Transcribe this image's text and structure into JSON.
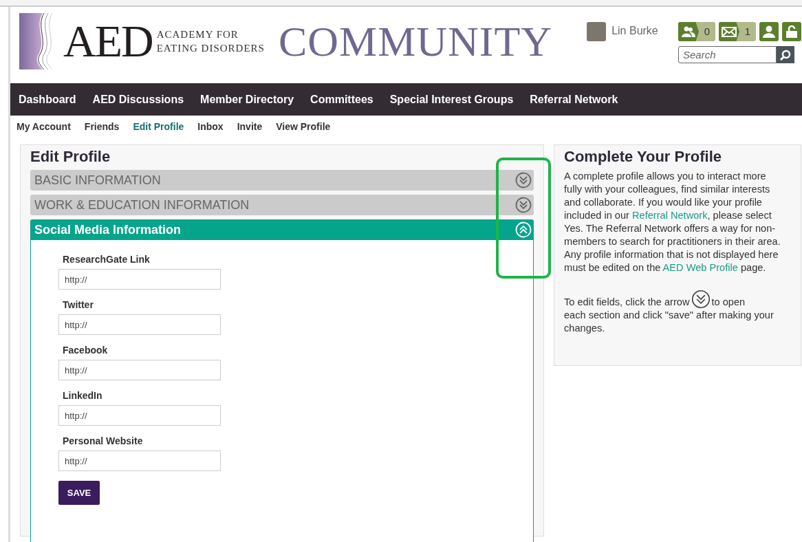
{
  "header": {
    "logo_mark": "AED",
    "logo_lines": [
      "ACADEMY FOR",
      "EATING DISORDERS"
    ],
    "site_title": "COMMUNITY",
    "user_name": "Lin Burke",
    "badges": [
      {
        "kind": "friends",
        "count": "0"
      },
      {
        "kind": "messages",
        "count": "1"
      },
      {
        "kind": "profile"
      },
      {
        "kind": "logout"
      }
    ],
    "search": {
      "placeholder": "Search"
    }
  },
  "main_nav": [
    "Dashboard",
    "AED Discussions",
    "Member Directory",
    "Committees",
    "Special Interest Groups",
    "Referral Network"
  ],
  "sub_nav": [
    {
      "label": "My Account",
      "selected": false
    },
    {
      "label": "Friends",
      "selected": false
    },
    {
      "label": "Edit Profile",
      "selected": true
    },
    {
      "label": "Inbox",
      "selected": false
    },
    {
      "label": "Invite",
      "selected": false
    },
    {
      "label": "View Profile",
      "selected": false
    }
  ],
  "edit_profile": {
    "title": "Edit Profile",
    "sections": [
      {
        "title": "BASIC INFORMATION",
        "expanded": false
      },
      {
        "title": "WORK & EDUCATION INFORMATION",
        "expanded": false
      },
      {
        "title": "Social Media Information",
        "expanded": true,
        "fields": [
          {
            "label": "ResearchGate Link",
            "value": "http://"
          },
          {
            "label": "Twitter",
            "value": "http://"
          },
          {
            "label": "Facebook",
            "value": "http://"
          },
          {
            "label": "LinkedIn",
            "value": "http://"
          },
          {
            "label": "Personal Website",
            "value": "http://"
          }
        ],
        "save_label": "SAVE"
      }
    ]
  },
  "sidebar": {
    "title": "Complete Your Profile",
    "paragraph_parts": [
      {
        "text": "A complete profile allows you to interact more fully with your colleagues, find similar interests and collaborate. If you would like your profile included in our ",
        "link": false
      },
      {
        "text": "Referral Network",
        "link": true
      },
      {
        "text": ", please select Yes. The Referral Network offers a way for non-members to search for practitioners in their area. Any profile information that is not displayed here must be edited on the ",
        "link": false
      },
      {
        "text": "AED Web Profile",
        "link": true
      },
      {
        "text": " page.",
        "link": false
      }
    ],
    "hint_parts": [
      "To edit fields, click the arrow",
      "to open",
      "each section and click \"save\" after making your changes."
    ]
  }
}
